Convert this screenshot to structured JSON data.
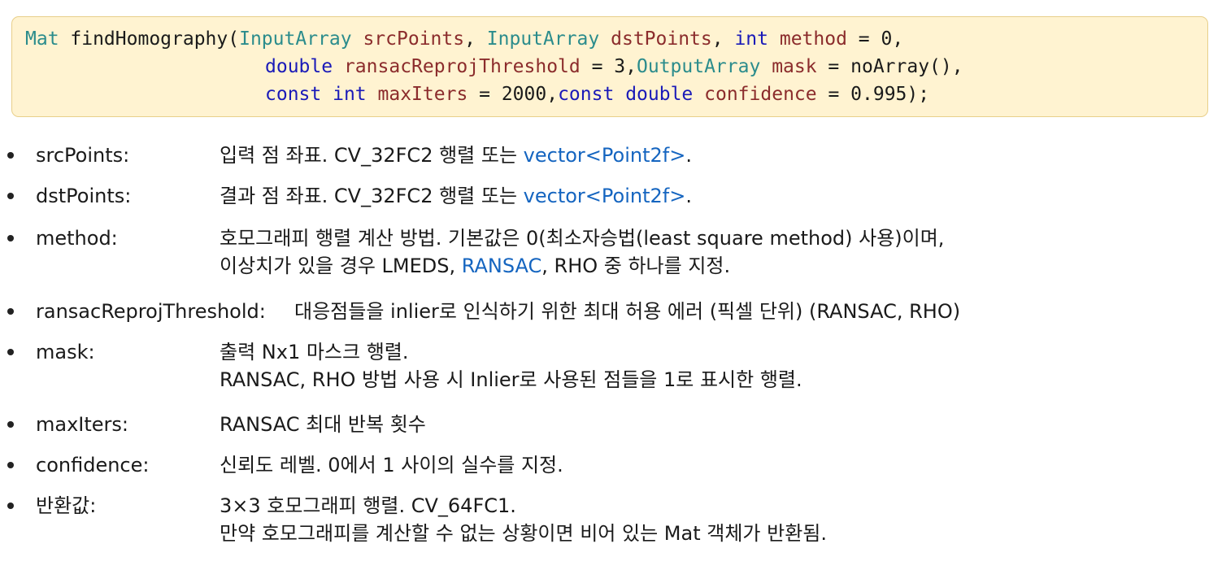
{
  "signature": {
    "line1": [
      {
        "t": "Mat",
        "c": "type"
      },
      {
        "t": " findHomography(",
        "c": "def"
      },
      {
        "t": "InputArray",
        "c": "type"
      },
      {
        "t": " ",
        "c": "def"
      },
      {
        "t": "srcPoints",
        "c": "var"
      },
      {
        "t": ", ",
        "c": "def"
      },
      {
        "t": "InputArray",
        "c": "type"
      },
      {
        "t": " ",
        "c": "def"
      },
      {
        "t": "dstPoints",
        "c": "var"
      },
      {
        "t": ", ",
        "c": "def"
      },
      {
        "t": "int",
        "c": "kw"
      },
      {
        "t": " ",
        "c": "def"
      },
      {
        "t": "method",
        "c": "var"
      },
      {
        "t": " = 0,",
        "c": "def"
      }
    ],
    "line2": [
      {
        "t": "double",
        "c": "kw"
      },
      {
        "t": " ",
        "c": "def"
      },
      {
        "t": "ransacReprojThreshold",
        "c": "var"
      },
      {
        "t": " = 3,",
        "c": "def"
      },
      {
        "t": "OutputArray",
        "c": "type"
      },
      {
        "t": " ",
        "c": "def"
      },
      {
        "t": "mask",
        "c": "var"
      },
      {
        "t": " = noArray(),",
        "c": "def"
      }
    ],
    "line3": [
      {
        "t": "const",
        "c": "kw"
      },
      {
        "t": " ",
        "c": "def"
      },
      {
        "t": "int",
        "c": "kw"
      },
      {
        "t": " ",
        "c": "def"
      },
      {
        "t": "maxIters",
        "c": "var"
      },
      {
        "t": " = 2000,",
        "c": "def"
      },
      {
        "t": "const",
        "c": "kw"
      },
      {
        "t": " ",
        "c": "def"
      },
      {
        "t": "double",
        "c": "kw"
      },
      {
        "t": " ",
        "c": "def"
      },
      {
        "t": "confidence",
        "c": "var"
      },
      {
        "t": " = 0.995);",
        "c": "def"
      }
    ]
  },
  "params": [
    {
      "name": "srcPoints:",
      "lines": [
        [
          {
            "t": "입력 점 좌표. CV_32FC2 행렬 또는 "
          },
          {
            "t": "vector<Point2f>",
            "link": true
          },
          {
            "t": "."
          }
        ]
      ]
    },
    {
      "name": "dstPoints:",
      "lines": [
        [
          {
            "t": "결과 점 좌표. CV_32FC2 행렬 또는 "
          },
          {
            "t": "vector<Point2f>",
            "link": true
          },
          {
            "t": "."
          }
        ]
      ]
    },
    {
      "name": "method:",
      "lines": [
        [
          {
            "t": "호모그래피 행렬 계산 방법. 기본값은 0(최소자승법(least square method) 사용)이며,"
          }
        ],
        [
          {
            "t": "이상치가 있을 경우 LMEDS, "
          },
          {
            "t": "RANSAC",
            "link": true
          },
          {
            "t": ", RHO 중 하나를 지정."
          }
        ]
      ]
    },
    {
      "name": "ransacReprojThreshold:",
      "wide": true,
      "lines": [
        [
          {
            "t": "대응점들을 inlier로 인식하기 위한 최대 허용 에러 (픽셀 단위) (RANSAC, RHO)"
          }
        ]
      ]
    },
    {
      "name": "mask:",
      "lines": [
        [
          {
            "t": "출력 Nx1 마스크 행렬."
          }
        ],
        [
          {
            "t": "RANSAC, RHO 방법 사용 시 Inlier로 사용된 점들을 1로 표시한 행렬."
          }
        ]
      ]
    },
    {
      "name": "maxIters:",
      "lines": [
        [
          {
            "t": "RANSAC 최대 반복 횟수"
          }
        ]
      ]
    },
    {
      "name": "confidence:",
      "lines": [
        [
          {
            "t": "신뢰도 레벨. 0에서 1 사이의 실수를 지정."
          }
        ]
      ]
    },
    {
      "name": "반환값:",
      "lines": [
        [
          {
            "t": "3×3 호모그래피 행렬. CV_64FC1."
          }
        ],
        [
          {
            "t": "만약 호모그래피를 계산할 수 없는 상황이면 비어 있는 Mat 객체가 반환됨."
          }
        ]
      ]
    }
  ],
  "colors": {
    "type": "#2b8c8c",
    "keyword": "#1a1ab8",
    "variable": "#8b2c2c",
    "link": "#1565c0",
    "code_bg": "#fff3d1"
  }
}
